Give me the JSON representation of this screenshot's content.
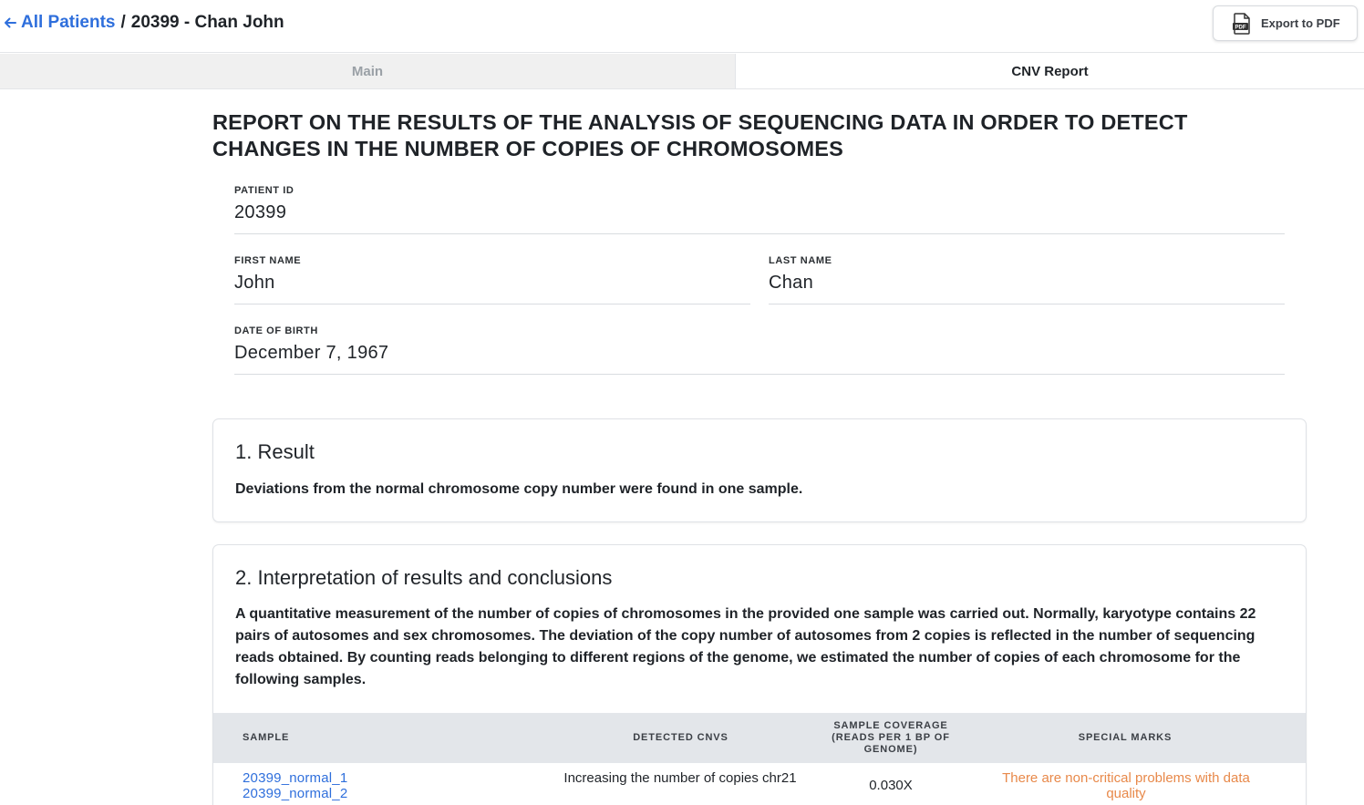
{
  "header": {
    "back_label": "All Patients",
    "separator": "/",
    "current": "20399 - Chan John",
    "export_label": "Export to PDF"
  },
  "tabs": [
    {
      "label": "Main",
      "active": false
    },
    {
      "label": "CNV Report",
      "active": true
    }
  ],
  "report": {
    "title": "REPORT ON THE RESULTS OF THE ANALYSIS OF SEQUENCING DATA IN ORDER TO DETECT CHANGES IN THE NUMBER OF COPIES OF CHROMOSOMES",
    "fields": {
      "patient_id": {
        "label": "PATIENT ID",
        "value": "20399"
      },
      "first_name": {
        "label": "FIRST NAME",
        "value": "John"
      },
      "last_name": {
        "label": "LAST NAME",
        "value": "Chan"
      },
      "dob": {
        "label": "DATE OF BIRTH",
        "value": "December 7, 1967"
      }
    }
  },
  "result": {
    "heading": "1. Result",
    "text": "Deviations from the normal chromosome copy number were found in one sample."
  },
  "interpretation": {
    "heading": "2. Interpretation of results and conclusions",
    "text": "A quantitative measurement of the number of copies of chromosomes in the provided one sample was carried out. Normally, karyotype contains 22 pairs of autosomes and sex chromosomes. The deviation of the copy number of autosomes from 2 copies is reflected in the number of sequencing reads obtained. By counting reads belonging to different regions of the genome, we estimated the number of copies of each chromosome for the following samples.",
    "table": {
      "headers": [
        "SAMPLE",
        "DETECTED CNVS",
        "SAMPLE COVERAGE (READS PER 1 BP OF GENOME)",
        "SPECIAL MARKS"
      ],
      "rows": [
        {
          "samples": [
            "20399_normal_1",
            "20399_normal_2"
          ],
          "cnvs": "Increasing the number of copies chr21",
          "coverage": "0.030X",
          "marks": "There are non-critical problems with data quality"
        }
      ]
    }
  },
  "colors": {
    "link": "#2f6fdc",
    "warning": "#e8894a",
    "table_header_bg": "#e3e6ea",
    "inactive_tab_bg": "#f0f0f0"
  }
}
